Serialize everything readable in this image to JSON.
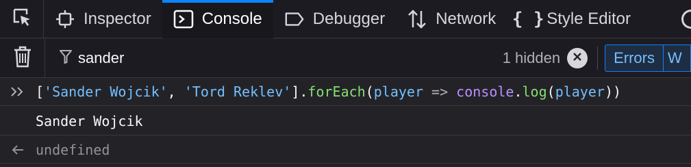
{
  "toolbar": {
    "picker_icon": "element-picker-icon",
    "tabs": [
      {
        "label": "Inspector",
        "icon": "inspector-icon"
      },
      {
        "label": "Console",
        "icon": "console-icon"
      },
      {
        "label": "Debugger",
        "icon": "debugger-icon"
      },
      {
        "label": "Network",
        "icon": "network-icon"
      },
      {
        "label": "Style Editor",
        "icon": "style-editor-icon"
      }
    ],
    "selected_tab": "Console"
  },
  "filterbar": {
    "filter_value": "sander",
    "hidden_count": "1 hidden",
    "errors_label": "Errors",
    "next_label": "W"
  },
  "console": {
    "input_tokens": {
      "t1": "[",
      "t2": "'Sander Wojcik'",
      "t3": ", ",
      "t4": "'Tord Reklev'",
      "t5": "].",
      "t6": "forEach",
      "t7": "(",
      "t8": "player",
      "t9": " => ",
      "t10": "console",
      "t11": ".",
      "t12": "log",
      "t13": "(",
      "t14": "player",
      "t15": "))"
    },
    "log_output": "Sander Wojcik",
    "result_value": "undefined"
  },
  "colors": {
    "accent": "#0a84ff",
    "string": "#75bfff",
    "function": "#b98eff",
    "method": "#86de74",
    "background": "#232327"
  }
}
